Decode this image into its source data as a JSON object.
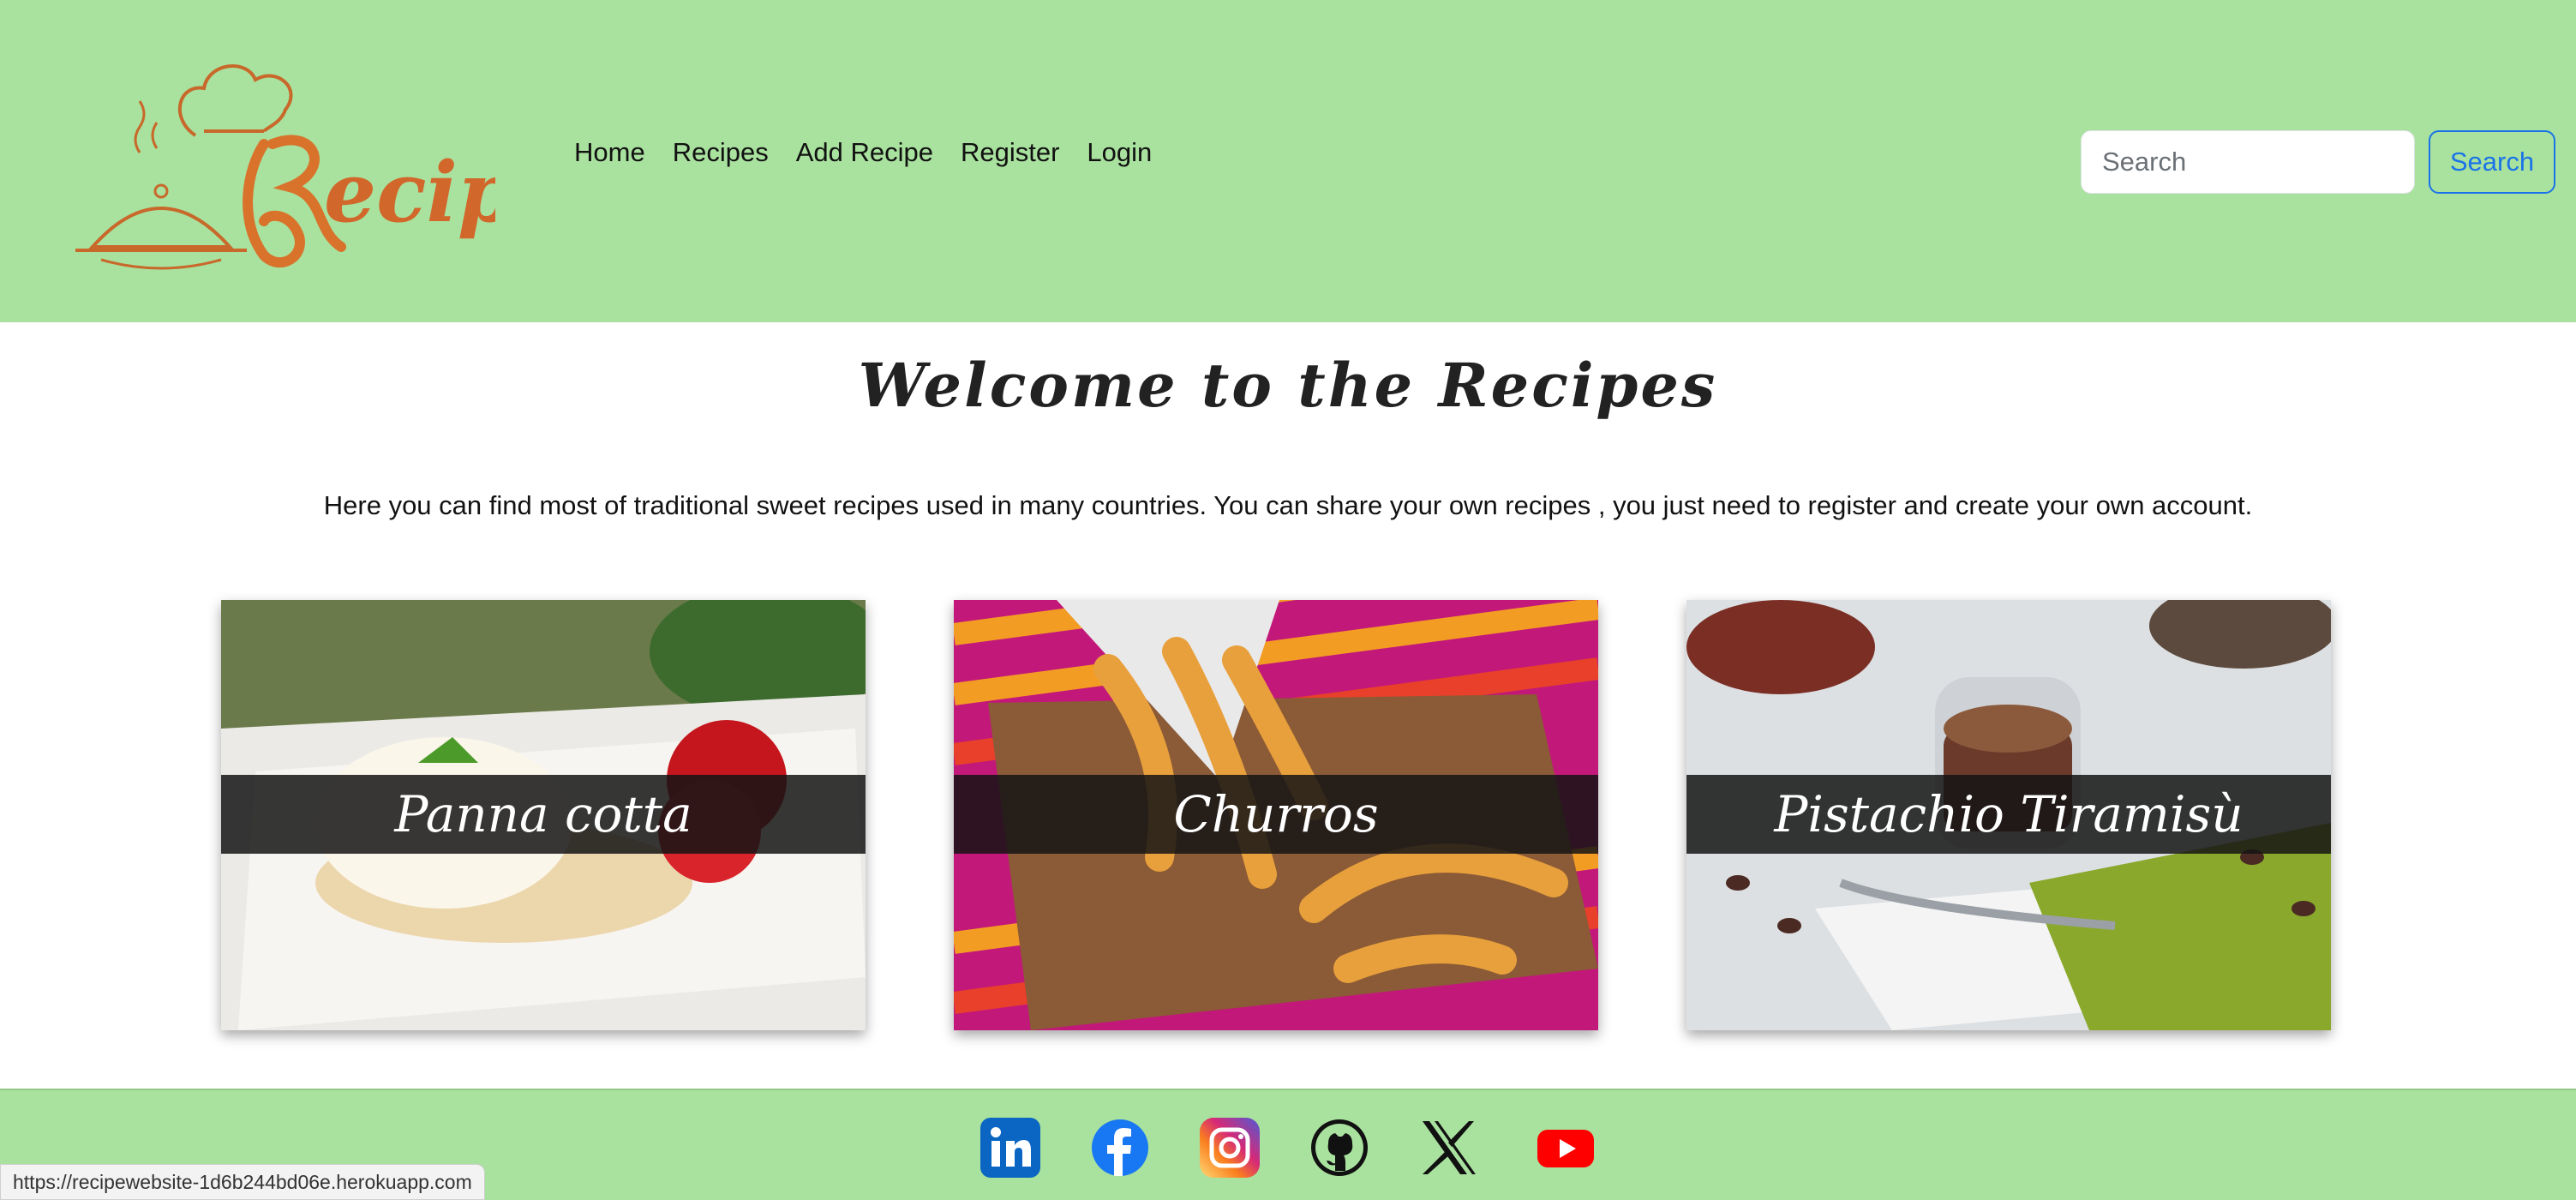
{
  "header": {
    "logo_alt": "Recipes",
    "nav": [
      "Home",
      "Recipes",
      "Add Recipe",
      "Register",
      "Login"
    ],
    "search": {
      "placeholder": "Search",
      "button_label": "Search"
    }
  },
  "main": {
    "title": "Welcome to the Recipes",
    "intro": "Here you can find most of traditional sweet recipes used in many countries. You can share your own recipes , you just need to register and create your own account.",
    "cards": [
      {
        "label": "Panna cotta"
      },
      {
        "label": "Churros"
      },
      {
        "label": "Pistachio Tiramisù"
      }
    ]
  },
  "footer": {
    "social_icons": [
      "linkedin-icon",
      "facebook-icon",
      "instagram-icon",
      "github-icon",
      "x-icon",
      "youtube-icon"
    ]
  },
  "status": {
    "url": "https://recipewebsite-1d6b244bd06e.herokuapp.com"
  },
  "colors": {
    "header_bg": "#a9e19e",
    "accent": "#1a73e8"
  }
}
